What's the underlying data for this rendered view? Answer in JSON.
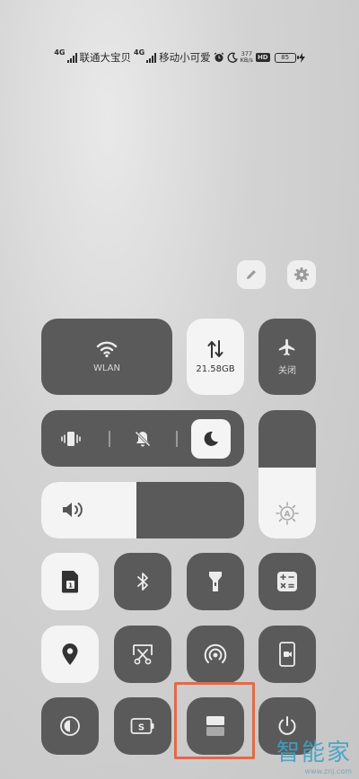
{
  "status_bar": {
    "sim1_network": "4G",
    "sim1_carrier": "联通大宝贝",
    "sim2_network": "4G",
    "sim2_carrier": "移动小可爱",
    "speed_value": "377",
    "speed_unit": "KB/s",
    "hd_badge": "HD",
    "battery_level": "85"
  },
  "top_buttons": {
    "edit": "pencil-icon",
    "settings": "gear-icon"
  },
  "tiles": {
    "wlan_label": "WLAN",
    "data_usage": "21.58GB",
    "airplane_label": "关闭"
  },
  "brightness_level": 0.55,
  "volume_level": 0.47,
  "watermark": {
    "title": "智能家",
    "url": "www.znj.com"
  },
  "colors": {
    "tile_dark": "#5a5a5a",
    "tile_light": "#f4f4f4",
    "highlight": "#e06a4a"
  }
}
